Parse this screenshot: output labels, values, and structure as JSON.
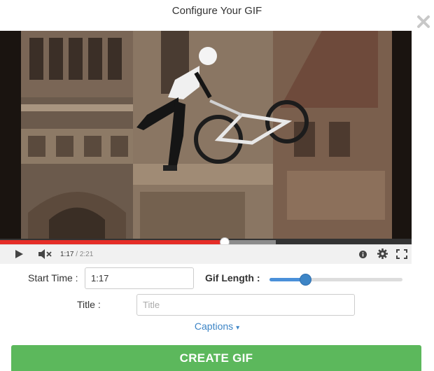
{
  "dialog": {
    "title": "Configure Your GIF",
    "close_icon": "close-icon"
  },
  "player": {
    "current_time": "1:17",
    "separator": " / ",
    "duration": "2:21",
    "progress_fraction": 0.546,
    "buffered_fraction": 0.67,
    "icons": [
      "play-icon",
      "mute-icon",
      "info-icon",
      "settings-gear-icon",
      "fullscreen-icon"
    ]
  },
  "form": {
    "start_time_label": "Start Time :",
    "start_time_value": "1:17",
    "gif_length_label": "Gif Length :",
    "gif_length_fraction": 0.27,
    "title_label": "Title :",
    "title_placeholder": "Title",
    "captions_label": "Captions",
    "captions_caret": "▾"
  },
  "actions": {
    "create_label": "CREATE GIF"
  },
  "colors": {
    "accent_blue": "#3d85c6",
    "create_green": "#5cb85c",
    "progress_red": "#e52d27"
  }
}
